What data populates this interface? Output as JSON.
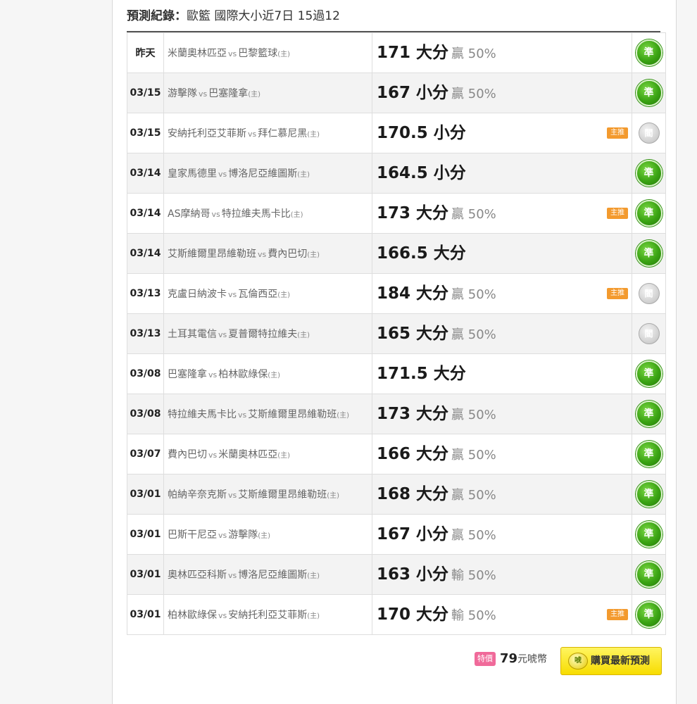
{
  "header": {
    "label": "預測紀錄",
    "separator": "：",
    "text": "歐籃 國際大小近7日 15過12"
  },
  "strings": {
    "vs": "vs",
    "home": "(主)"
  },
  "rows": [
    {
      "date": "昨天",
      "home": "米蘭奧林匹亞",
      "away": "巴黎籃球",
      "pick": "171 大分",
      "result": "贏 50%",
      "main": "",
      "status": "準",
      "status_type": "hit"
    },
    {
      "date": "03/15",
      "home": "游擊隊",
      "away": "巴塞隆拿",
      "pick": "167 小分",
      "result": "贏 50%",
      "main": "",
      "status": "準",
      "status_type": "hit"
    },
    {
      "date": "03/15",
      "home": "安納托利亞艾菲斯",
      "away": "拜仁慕尼黑",
      "pick": "170.5 小分",
      "result": "",
      "main": "主推",
      "status": "閻",
      "status_type": "push"
    },
    {
      "date": "03/14",
      "home": "皇家馬德里",
      "away": "博洛尼亞維圖斯",
      "pick": "164.5 小分",
      "result": "",
      "main": "",
      "status": "準",
      "status_type": "hit"
    },
    {
      "date": "03/14",
      "home": "AS摩納哥",
      "away": "特拉維夫馬卡比",
      "pick": "173 大分",
      "result": "贏 50%",
      "main": "主推",
      "status": "準",
      "status_type": "hit"
    },
    {
      "date": "03/14",
      "home": "艾斯維爾里昂維勒班",
      "away": "費內巴切",
      "pick": "166.5 大分",
      "result": "",
      "main": "",
      "status": "準",
      "status_type": "hit"
    },
    {
      "date": "03/13",
      "home": "克盧日納波卡",
      "away": "瓦倫西亞",
      "pick": "184 大分",
      "result": "贏 50%",
      "main": "主推",
      "status": "閻",
      "status_type": "push"
    },
    {
      "date": "03/13",
      "home": "土耳其電信",
      "away": "夏普爾特拉維夫",
      "pick": "165 大分",
      "result": "贏 50%",
      "main": "",
      "status": "閻",
      "status_type": "push"
    },
    {
      "date": "03/08",
      "home": "巴塞隆拿",
      "away": "柏林歐綠保",
      "pick": "171.5 大分",
      "result": "",
      "main": "",
      "status": "準",
      "status_type": "hit"
    },
    {
      "date": "03/08",
      "home": "特拉維夫馬卡比",
      "away": "艾斯維爾里昂維勒班",
      "pick": "173 大分",
      "result": "贏 50%",
      "main": "",
      "status": "準",
      "status_type": "hit"
    },
    {
      "date": "03/07",
      "home": "費內巴切",
      "away": "米蘭奧林匹亞",
      "pick": "166 大分",
      "result": "贏 50%",
      "main": "",
      "status": "準",
      "status_type": "hit"
    },
    {
      "date": "03/01",
      "home": "帕納辛奈克斯",
      "away": "艾斯維爾里昂維勒班",
      "pick": "168 大分",
      "result": "贏 50%",
      "main": "",
      "status": "準",
      "status_type": "hit"
    },
    {
      "date": "03/01",
      "home": "巴斯干尼亞",
      "away": "游擊隊",
      "pick": "167 小分",
      "result": "贏 50%",
      "main": "",
      "status": "準",
      "status_type": "hit"
    },
    {
      "date": "03/01",
      "home": "奧林匹亞科斯",
      "away": "博洛尼亞維圖斯",
      "pick": "163 小分",
      "result": "輸 50%",
      "main": "",
      "status": "準",
      "status_type": "hit"
    },
    {
      "date": "03/01",
      "home": "柏林歐綠保",
      "away": "安納托利亞艾菲斯",
      "pick": "170 大分",
      "result": "輸 50%",
      "main": "主推",
      "status": "準",
      "status_type": "hit"
    }
  ],
  "footer": {
    "special_tag": "特價",
    "price": "79",
    "price_unit": "元唬幣",
    "buy_icon": "唬",
    "buy_label": "購買最新預測"
  },
  "colors": {
    "hit": "#3aa313",
    "push": "#cfcfcf",
    "main_badge": "#f39a2e",
    "buy_button": "#f7dc00"
  }
}
